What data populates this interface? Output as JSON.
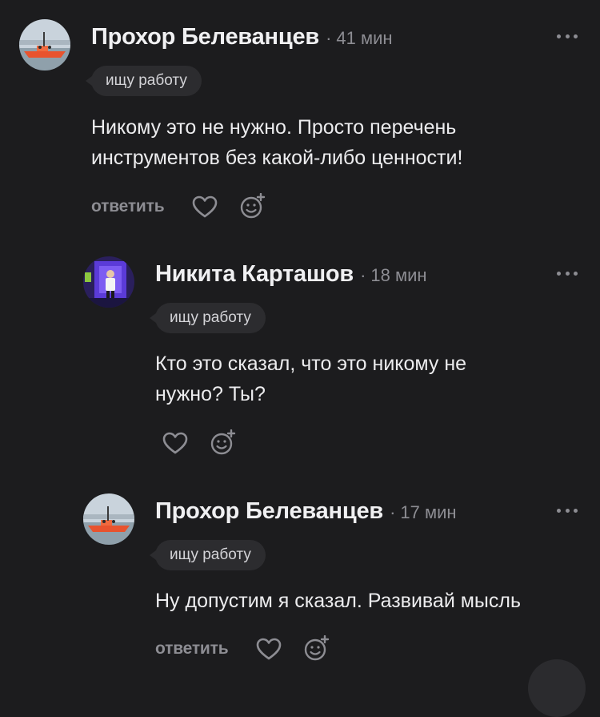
{
  "comments": [
    {
      "author": "Прохор Белеванцев",
      "time": "41 мин",
      "badge": "ищу работу",
      "text_lines": [
        "Никому это не нужно. Просто перечень",
        "инструментов без какой-либо ценности!"
      ],
      "reply_label": "ответить",
      "avatar_icon": "boat-photo-avatar"
    },
    {
      "author": "Никита Карташов",
      "time": "18 мин",
      "badge": "ищу работу",
      "text_lines": [
        "Кто это сказал, что это никому не",
        "нужно? Ты?"
      ],
      "avatar_icon": "person-photo-avatar"
    },
    {
      "author": "Прохор Белеванцев",
      "time": "17 мин",
      "badge": "ищу работу",
      "text_lines": [
        "Ну допустим я сказал. Развивай мысль"
      ],
      "reply_label": "ответить",
      "avatar_icon": "boat-photo-avatar"
    }
  ],
  "meta_separator": "·",
  "icons": {
    "more": "more-dots-icon",
    "like": "heart-icon",
    "react": "emoji-add-icon"
  },
  "colors": {
    "background": "#1c1c1e",
    "text": "#ececee",
    "muted": "#8d8d93",
    "badge_bg": "#2c2c2f"
  }
}
